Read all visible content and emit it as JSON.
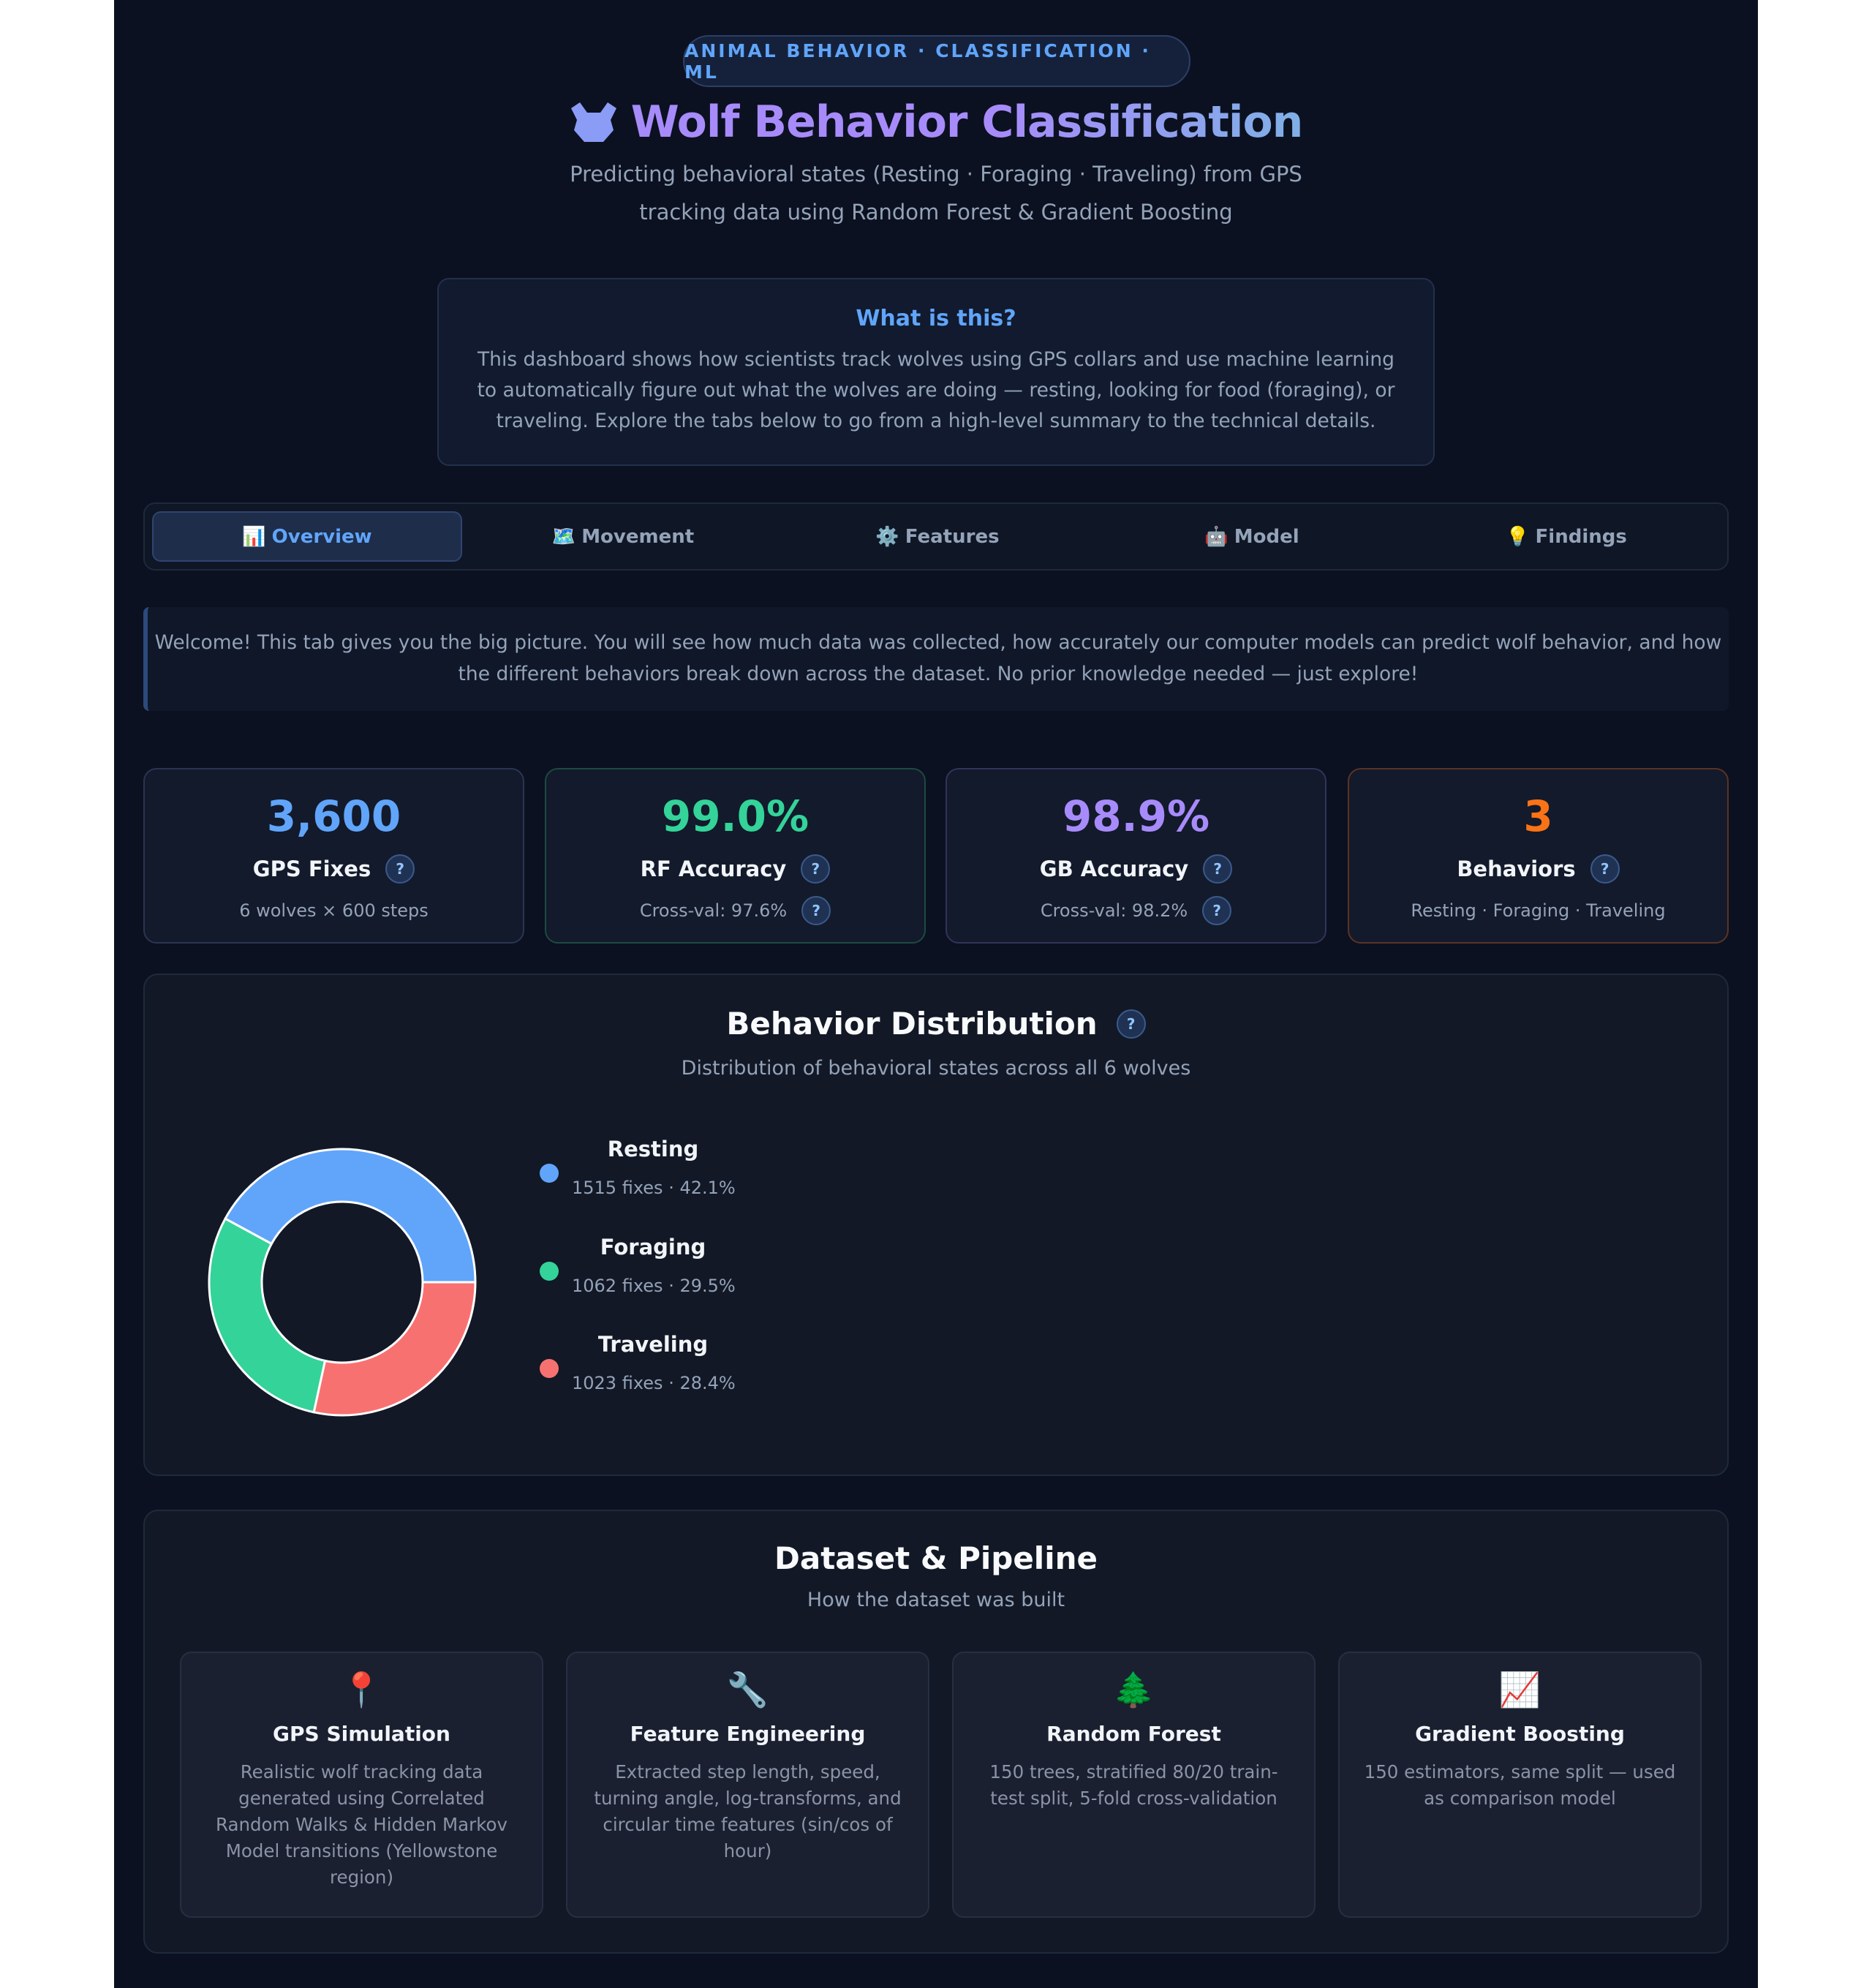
{
  "header": {
    "badge": "ANIMAL BEHAVIOR · CLASSIFICATION · ML",
    "title": "Wolf Behavior Classification",
    "subtitle": "Predicting behavioral states (Resting · Foraging · Traveling) from GPS tracking data using Random Forest & Gradient Boosting"
  },
  "intro": {
    "title": "What is this?",
    "text": "This dashboard shows how scientists track wolves using GPS collars and use machine learning to automatically figure out what the wolves are doing — resting, looking for food (foraging), or traveling. Explore the tabs below to go from a high-level summary to the technical details."
  },
  "tabs": [
    {
      "icon": "📊",
      "label": "Overview",
      "active": true
    },
    {
      "icon": "🗺️",
      "label": "Movement",
      "active": false
    },
    {
      "icon": "⚙️",
      "label": "Features",
      "active": false
    },
    {
      "icon": "🤖",
      "label": "Model",
      "active": false
    },
    {
      "icon": "💡",
      "label": "Findings",
      "active": false
    }
  ],
  "welcome": "Welcome! This tab gives you the big picture. You will see how much data was collected, how accurately our computer models can predict wolf behavior, and how the different behaviors break down across the dataset. No prior knowledge needed — just explore!",
  "kpis": [
    {
      "value": "3,600",
      "label": "GPS Fixes",
      "sub": "6 wolves × 600 steps",
      "color": "#60a5fa",
      "border": "#2a3553"
    },
    {
      "value": "99.0%",
      "label": "RF Accuracy",
      "sub": "Cross-val: 97.6%",
      "color": "#34d399",
      "border": "#1d4a42"
    },
    {
      "value": "98.9%",
      "label": "GB Accuracy",
      "sub": "Cross-val: 98.2%",
      "color": "#a78bfa",
      "border": "#33335a"
    },
    {
      "value": "3",
      "label": "Behaviors",
      "sub": "Resting · Foraging · Traveling",
      "color": "#f97316",
      "border": "#5a3325"
    }
  ],
  "help_glyph": "?",
  "distribution": {
    "title": "Behavior Distribution",
    "subtitle": "Distribution of behavioral states across all 6 wolves"
  },
  "chart_data": {
    "type": "pie",
    "donut": true,
    "title": "Behavior Distribution",
    "categories": [
      "Resting",
      "Foraging",
      "Traveling"
    ],
    "values": [
      1515,
      1062,
      1023
    ],
    "percents": [
      42.1,
      29.5,
      28.4
    ],
    "labels": [
      "1515 fixes · 42.1%",
      "1062 fixes · 29.5%",
      "1023 fixes · 28.4%"
    ],
    "colors": [
      "#60a5fa",
      "#34d399",
      "#f87171"
    ],
    "legend": "right"
  },
  "pipeline": {
    "title": "Dataset & Pipeline",
    "subtitle": "How the dataset was built",
    "steps": [
      {
        "icon": "📍",
        "name": "GPS Simulation",
        "desc": "Realistic wolf tracking data generated using Correlated Random Walks & Hidden Markov Model transitions (Yellowstone region)"
      },
      {
        "icon": "🔧",
        "name": "Feature Engineering",
        "desc": "Extracted step length, speed, turning angle, log-transforms, and circular time features (sin/cos of hour)"
      },
      {
        "icon": "🌲",
        "name": "Random Forest",
        "desc": "150 trees, stratified 80/20 train-test split, 5-fold cross-validation"
      },
      {
        "icon": "📈",
        "name": "Gradient Boosting",
        "desc": "150 estimators, same split — used as comparison model"
      }
    ]
  }
}
